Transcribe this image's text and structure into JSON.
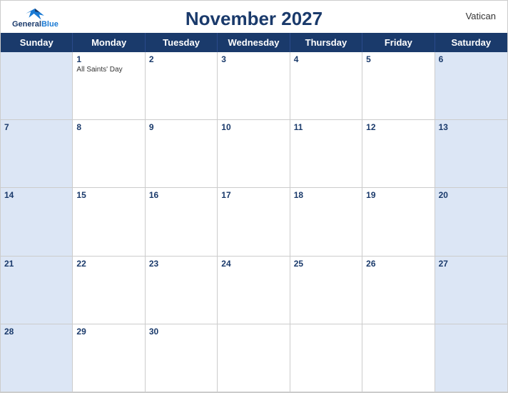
{
  "header": {
    "title": "November 2027",
    "country": "Vatican",
    "logo": {
      "line1": "General",
      "line2": "Blue"
    }
  },
  "days": {
    "headers": [
      "Sunday",
      "Monday",
      "Tuesday",
      "Wednesday",
      "Thursday",
      "Friday",
      "Saturday"
    ]
  },
  "weeks": [
    [
      {
        "day": "",
        "type": "sunday",
        "empty": true
      },
      {
        "day": "1",
        "type": "monday",
        "event": "All Saints' Day"
      },
      {
        "day": "2",
        "type": "tuesday"
      },
      {
        "day": "3",
        "type": "wednesday"
      },
      {
        "day": "4",
        "type": "thursday"
      },
      {
        "day": "5",
        "type": "friday"
      },
      {
        "day": "6",
        "type": "saturday"
      }
    ],
    [
      {
        "day": "7",
        "type": "sunday"
      },
      {
        "day": "8",
        "type": "monday"
      },
      {
        "day": "9",
        "type": "tuesday"
      },
      {
        "day": "10",
        "type": "wednesday"
      },
      {
        "day": "11",
        "type": "thursday"
      },
      {
        "day": "12",
        "type": "friday"
      },
      {
        "day": "13",
        "type": "saturday"
      }
    ],
    [
      {
        "day": "14",
        "type": "sunday"
      },
      {
        "day": "15",
        "type": "monday"
      },
      {
        "day": "16",
        "type": "tuesday"
      },
      {
        "day": "17",
        "type": "wednesday"
      },
      {
        "day": "18",
        "type": "thursday"
      },
      {
        "day": "19",
        "type": "friday"
      },
      {
        "day": "20",
        "type": "saturday"
      }
    ],
    [
      {
        "day": "21",
        "type": "sunday"
      },
      {
        "day": "22",
        "type": "monday"
      },
      {
        "day": "23",
        "type": "tuesday"
      },
      {
        "day": "24",
        "type": "wednesday"
      },
      {
        "day": "25",
        "type": "thursday"
      },
      {
        "day": "26",
        "type": "friday"
      },
      {
        "day": "27",
        "type": "saturday"
      }
    ],
    [
      {
        "day": "28",
        "type": "sunday"
      },
      {
        "day": "29",
        "type": "monday"
      },
      {
        "day": "30",
        "type": "tuesday"
      },
      {
        "day": "",
        "type": "wednesday",
        "empty": true
      },
      {
        "day": "",
        "type": "thursday",
        "empty": true
      },
      {
        "day": "",
        "type": "friday",
        "empty": true
      },
      {
        "day": "",
        "type": "saturday",
        "empty": true
      }
    ]
  ]
}
